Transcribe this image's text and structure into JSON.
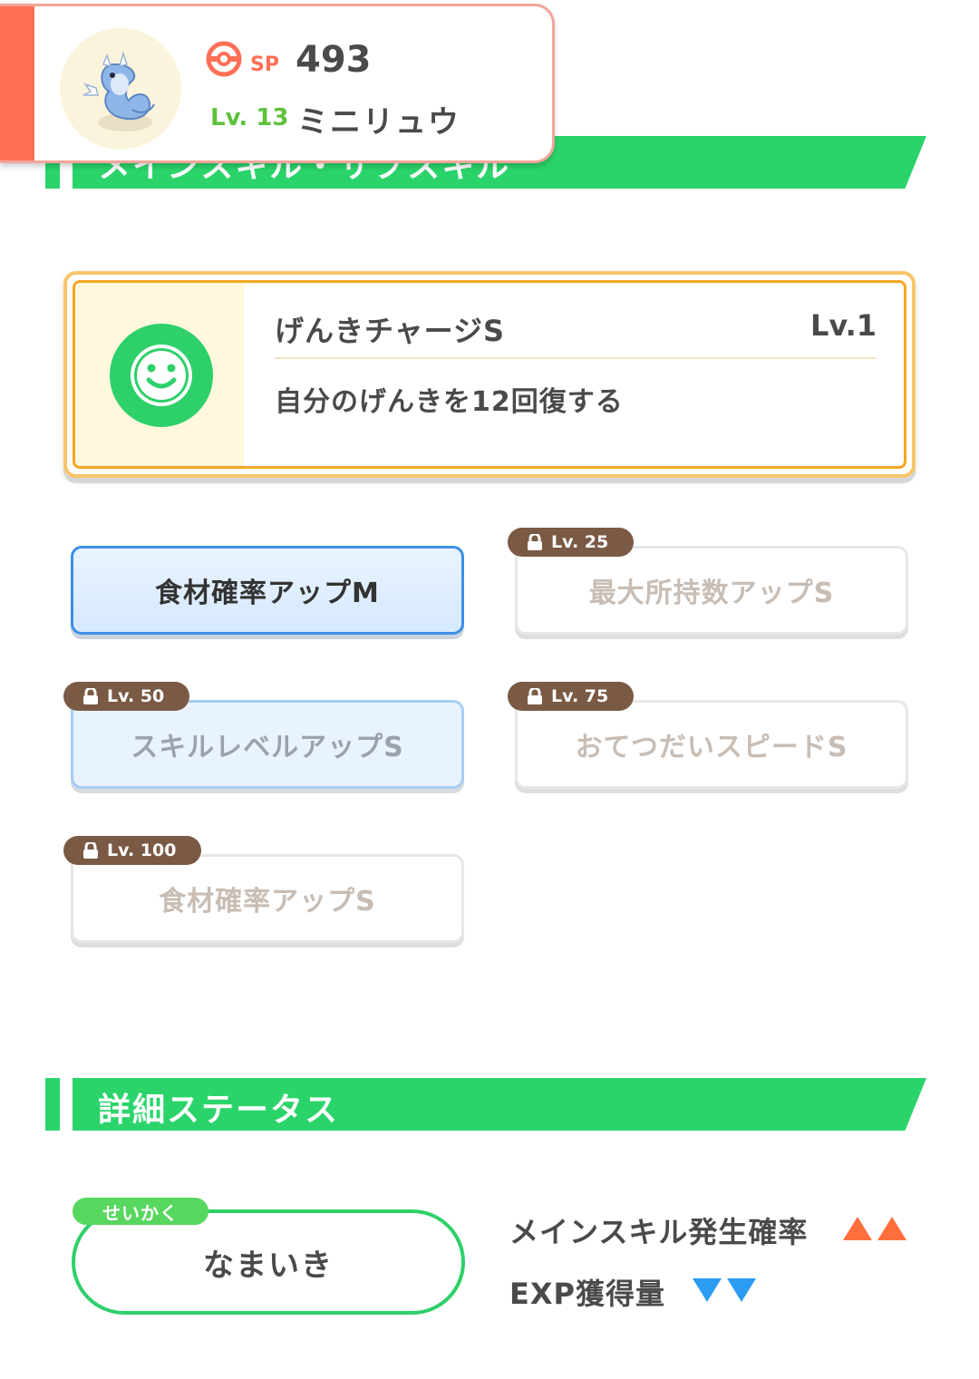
{
  "pokemon": {
    "sp_label": "SP",
    "sp_value": "493",
    "level": "Lv. 13",
    "name": "ミニリュウ",
    "accent_color": "#ff6f55",
    "avatar_icon": "dratini-portrait"
  },
  "sections": {
    "skills_title": "メインスキル・サブスキル",
    "details_title": "詳細ステータス"
  },
  "main_skill": {
    "name": "げんきチャージS",
    "level": "Lv.1",
    "description": "自分のげんきを12回復する",
    "icon": "smiley-face-icon"
  },
  "sub_skills": [
    {
      "label": "食材確率アップM",
      "unlock_level": null,
      "state": "active"
    },
    {
      "label": "最大所持数アップS",
      "unlock_level": "Lv. 25",
      "state": "locked"
    },
    {
      "label": "スキルレベルアップS",
      "unlock_level": "Lv. 50",
      "state": "locked-blue"
    },
    {
      "label": "おてつだいスピードS",
      "unlock_level": "Lv. 75",
      "state": "locked"
    },
    {
      "label": "食材確率アップS",
      "unlock_level": "Lv. 100",
      "state": "locked"
    }
  ],
  "nature": {
    "tag": "せいかく",
    "value": "なまいき",
    "effects": [
      {
        "label": "メインスキル発生確率",
        "direction": "up",
        "count": 2,
        "color": "#ff6f3c"
      },
      {
        "label": "EXP獲得量",
        "direction": "down",
        "count": 2,
        "color": "#2b9cf2"
      }
    ]
  },
  "colors": {
    "header_green": "#2bd46b",
    "active_blue": "#3c8fe8",
    "lock_brown": "#7a5a45"
  }
}
